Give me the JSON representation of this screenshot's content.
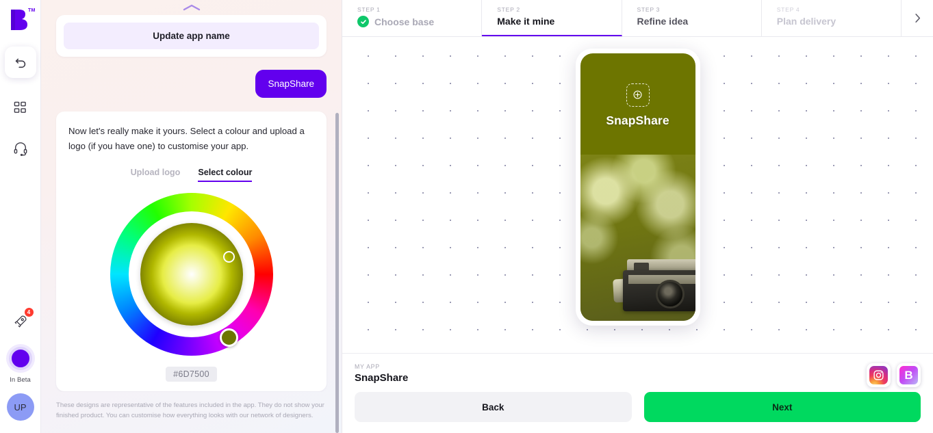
{
  "rail": {
    "logo_mark": "B",
    "logo_tm": "TM",
    "undo_icon": "undo-icon",
    "grid_icon": "grid-icon",
    "support_icon": "headset-icon",
    "rocket_icon": "rocket-icon",
    "rocket_badge": "4",
    "beta_label": "In Beta",
    "avatar_initials": "UP"
  },
  "chat": {
    "collapse_icon": "chevron-up-icon",
    "update_name_label": "Update app name",
    "user_message": "SnapShare",
    "intro_text": "Now let's really make it yours. Select a colour and upload a logo (if you have one) to customise your app.",
    "tabs": [
      {
        "label": "Upload logo",
        "active": false
      },
      {
        "label": "Select colour",
        "active": true
      }
    ],
    "colour": {
      "hex": "#6D7500",
      "hue_css": "#dde600",
      "sv_handle_name": "saturation-brightness-handle",
      "hue_handle_name": "hue-ring-handle"
    },
    "disclaimer": "These designs are representative of the features included in the app. They do not show your finished product. You can customise how everything looks with our network of designers."
  },
  "steps": [
    {
      "num": "STEP 1",
      "name": "Choose base",
      "state": "done"
    },
    {
      "num": "STEP 2",
      "name": "Make it mine",
      "state": "current"
    },
    {
      "num": "STEP 3",
      "name": "Refine idea",
      "state": "pending-dark"
    },
    {
      "num": "STEP 4",
      "name": "Plan delivery",
      "state": "pending-light"
    }
  ],
  "steps_next_icon": "chevron-right-icon",
  "preview": {
    "add_logo_icon": "add-logo-placeholder-icon",
    "app_name": "SnapShare",
    "brand_colour": "#6D7500"
  },
  "bottom": {
    "my_app_label": "MY APP",
    "app_name": "SnapShare",
    "icons": [
      {
        "name": "instagram-app-icon",
        "glyph": "instagram"
      },
      {
        "name": "builder-app-icon",
        "glyph": "B"
      }
    ],
    "back_label": "Back",
    "next_label": "Next"
  }
}
